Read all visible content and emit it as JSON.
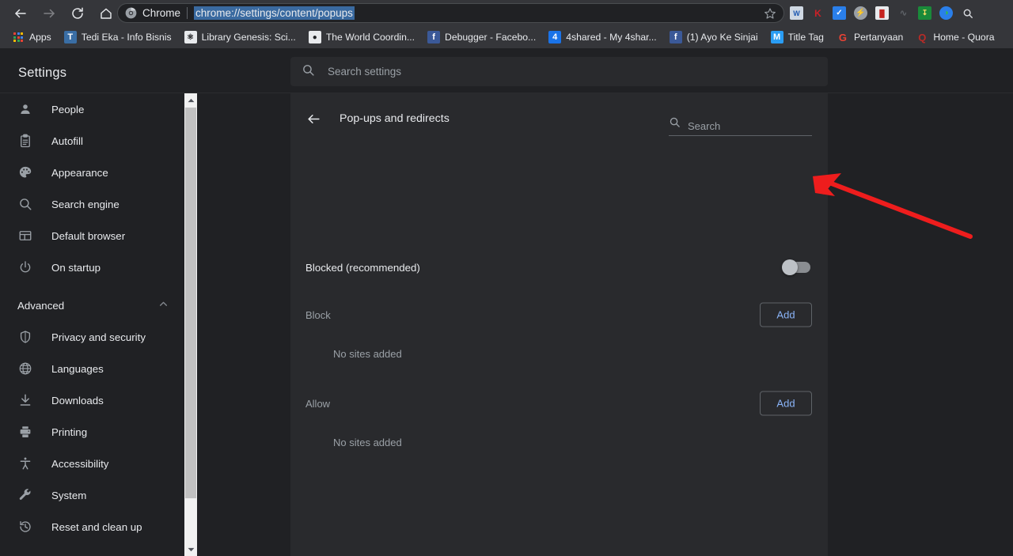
{
  "browser": {
    "nav": {
      "back_label": "Back",
      "forward_label": "Forward",
      "reload_label": "Reload",
      "home_label": "Home"
    },
    "omnibox": {
      "scheme_label": "Chrome",
      "url": "chrome://settings/content/popups",
      "url_selected": true,
      "star_label": "Bookmark this page"
    },
    "extensions": [
      {
        "name": "office-document-extension",
        "glyph": "W",
        "bg": "#4285f4",
        "fg": "#ffffff"
      },
      {
        "name": "kaspersky-extension",
        "glyph": "K",
        "bg": "#2a2b2e",
        "fg": "#cc2027"
      },
      {
        "name": "chart-tracker-extension",
        "glyph": "✓",
        "bg": "#2a7fea",
        "fg": "#ffffff"
      },
      {
        "name": "flash-extension",
        "glyph": "⚡",
        "bg": "#9aa0a6",
        "fg": "#3c4043"
      },
      {
        "name": "adblock-mask-extension",
        "glyph": "▬",
        "bg": "#e8eaed",
        "fg": "#c5221f"
      },
      {
        "name": "scribble-extension",
        "glyph": "⌇",
        "bg": "transparent",
        "fg": "#5f6368"
      },
      {
        "name": "idm-download-extension",
        "glyph": "↕",
        "bg": "#1a8a3a",
        "fg": "#ffe066"
      },
      {
        "name": "paint-palette-extension",
        "glyph": "◕",
        "bg": "#2a7fea",
        "fg": "#35c13a"
      },
      {
        "name": "search-magnifier-extension",
        "glyph": "🔍",
        "bg": "transparent",
        "fg": "#dadce0"
      }
    ],
    "bookmarks": {
      "apps_label": "Apps",
      "items": [
        {
          "label": "Tedi Eka - Info Bisnis",
          "glyph": "T",
          "bg": "#3a6ea5",
          "fg": "#ffffff"
        },
        {
          "label": "Library Genesis: Sci...",
          "glyph": "⚗",
          "bg": "#e8eaed",
          "fg": "#202124"
        },
        {
          "label": "The World Coordin...",
          "glyph": "●",
          "bg": "#e8eaed",
          "fg": "#202124"
        },
        {
          "label": "Debugger - Facebo...",
          "glyph": "f",
          "bg": "#3b5998",
          "fg": "#ffffff"
        },
        {
          "label": "4shared - My 4shar...",
          "glyph": "4",
          "bg": "#1a73e8",
          "fg": "#ffffff"
        },
        {
          "label": "(1) Ayo Ke Sinjai",
          "glyph": "f",
          "bg": "#3b5998",
          "fg": "#ffffff"
        },
        {
          "label": "Title Tag",
          "glyph": "M",
          "bg": "#2a9df4",
          "fg": "#ffffff"
        },
        {
          "label": "Pertanyaan",
          "glyph": "G",
          "bg": "transparent",
          "fg": "#ea4335"
        },
        {
          "label": "Home - Quora",
          "glyph": "Q",
          "bg": "transparent",
          "fg": "#b92b27"
        }
      ]
    }
  },
  "settings": {
    "title": "Settings",
    "search": {
      "placeholder": "Search settings",
      "value": "",
      "icon": "search-icon"
    },
    "sidebar": {
      "items": [
        {
          "label": "People",
          "icon": "person-icon"
        },
        {
          "label": "Autofill",
          "icon": "clipboard-icon"
        },
        {
          "label": "Appearance",
          "icon": "palette-icon"
        },
        {
          "label": "Search engine",
          "icon": "search-icon"
        },
        {
          "label": "Default browser",
          "icon": "browser-window-icon"
        },
        {
          "label": "On startup",
          "icon": "power-icon"
        }
      ],
      "advanced": {
        "label": "Advanced",
        "expanded": true,
        "chevron": "chevron-up-icon"
      },
      "advanced_items": [
        {
          "label": "Privacy and security",
          "icon": "shield-icon"
        },
        {
          "label": "Languages",
          "icon": "globe-icon"
        },
        {
          "label": "Downloads",
          "icon": "download-icon"
        },
        {
          "label": "Printing",
          "icon": "printer-icon"
        },
        {
          "label": "Accessibility",
          "icon": "accessibility-icon"
        },
        {
          "label": "System",
          "icon": "wrench-icon"
        },
        {
          "label": "Reset and clean up",
          "icon": "history-restore-icon"
        }
      ]
    },
    "page": {
      "back_icon": "arrow-left-icon",
      "title": "Pop-ups and redirects",
      "search": {
        "placeholder": "Search",
        "value": "",
        "icon": "search-icon"
      },
      "toggle": {
        "label": "Blocked (recommended)",
        "state": "off"
      },
      "sections": [
        {
          "name": "block",
          "label": "Block",
          "add_label": "Add",
          "empty_label": "No sites added"
        },
        {
          "name": "allow",
          "label": "Allow",
          "add_label": "Add",
          "empty_label": "No sites added"
        }
      ]
    }
  },
  "annotation": {
    "arrow_color": "#ee1d1d",
    "points_at": "popups-toggle"
  },
  "colors": {
    "page_bg": "#202124",
    "card_bg": "#292a2d",
    "toolbar_bg": "#35363a",
    "text_primary": "#e8eaed",
    "text_secondary": "#9aa0a6",
    "accent_blue": "#8ab4f8",
    "url_selection": "#3a6aa0",
    "scrollbar_track": "#f1f1f1",
    "scrollbar_thumb": "#c1c1c1"
  }
}
